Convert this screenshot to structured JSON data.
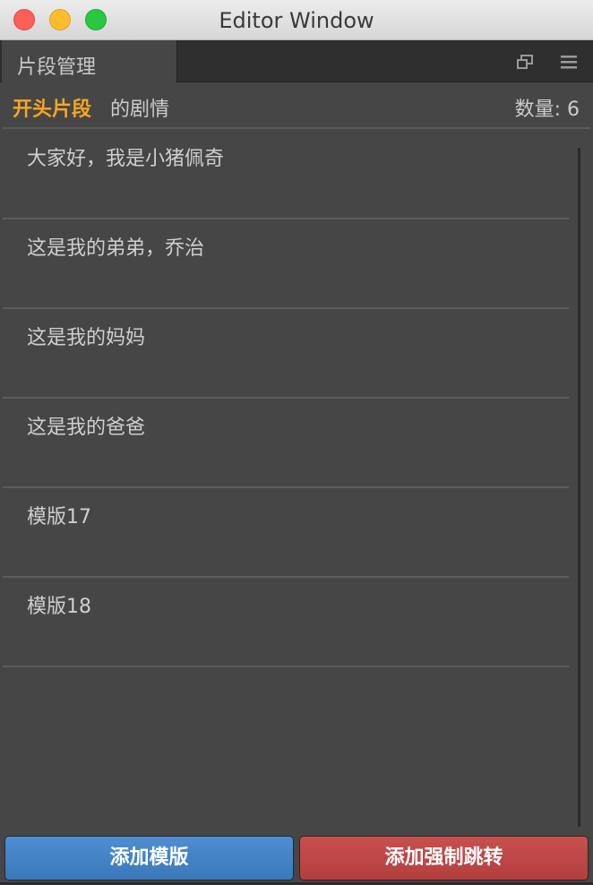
{
  "window": {
    "title": "Editor Window"
  },
  "tab": {
    "label": "片段管理"
  },
  "header": {
    "segment_name": "开头片段",
    "suffix": "的剧情",
    "count_label": "数量: 6"
  },
  "items": [
    {
      "label": "大家好，我是小猪佩奇"
    },
    {
      "label": "这是我的弟弟，乔治"
    },
    {
      "label": "这是我的妈妈"
    },
    {
      "label": "这是我的爸爸"
    },
    {
      "label": "模版17"
    },
    {
      "label": "模版18"
    }
  ],
  "buttons": {
    "add_template": "添加模版",
    "add_forced_jump": "添加强制跳转"
  },
  "colors": {
    "accent_orange": "#f6a623",
    "button_blue": "#3a78bb",
    "button_red": "#b23f3e"
  }
}
